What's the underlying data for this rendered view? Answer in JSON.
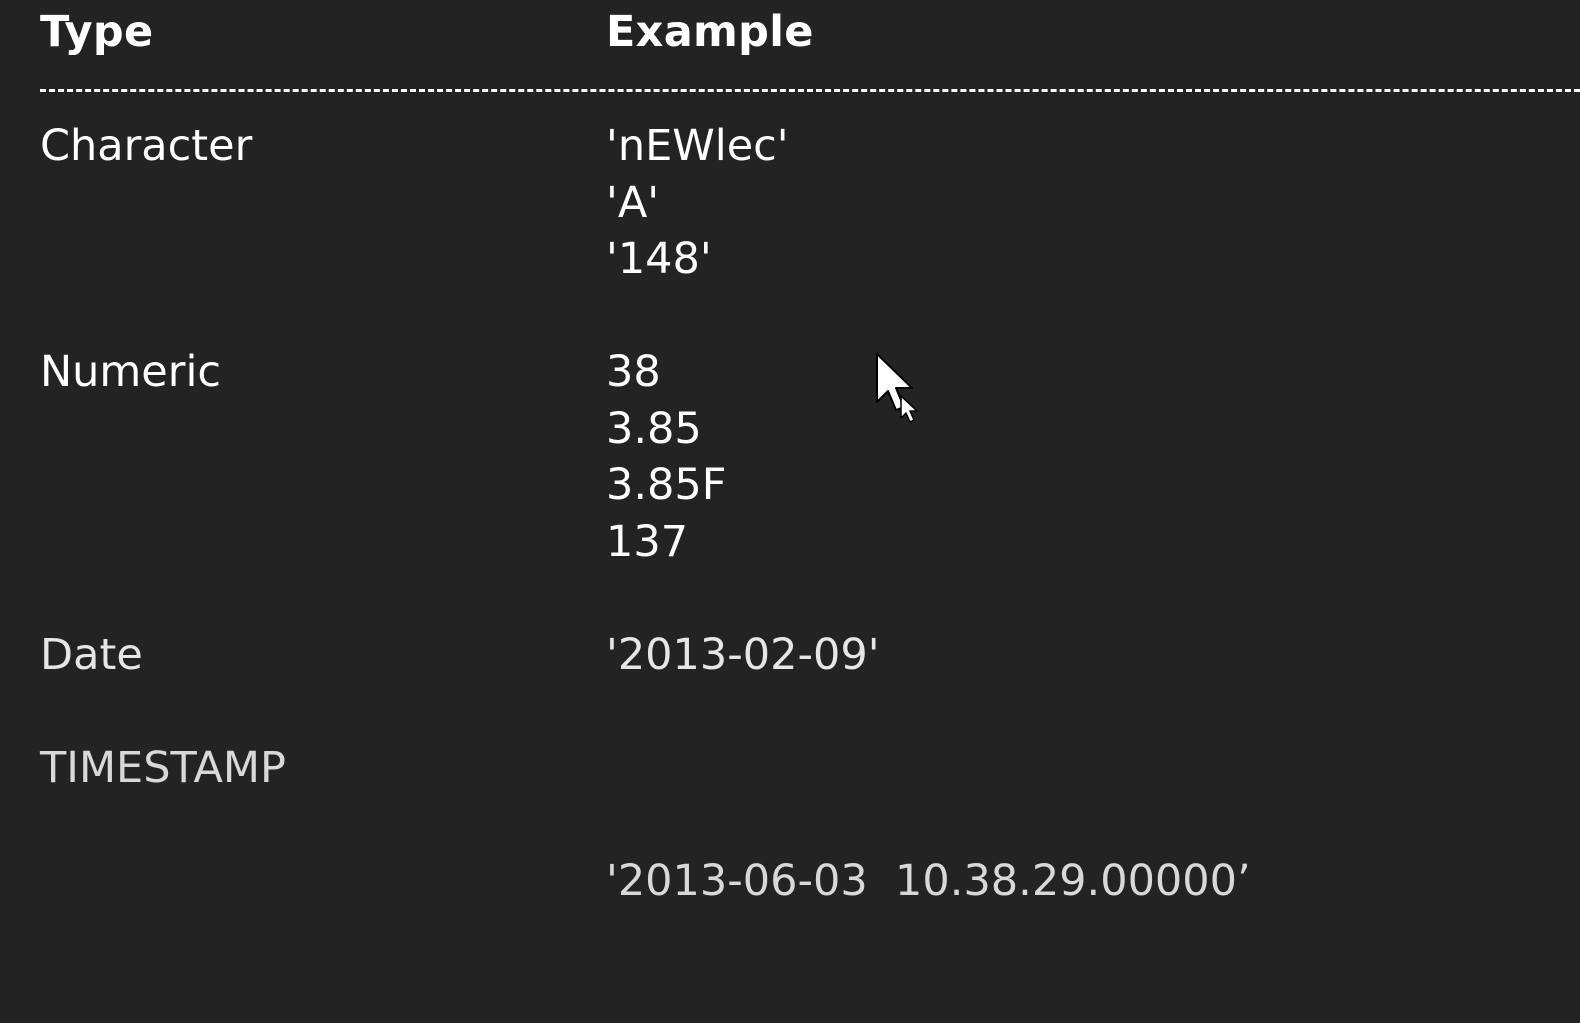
{
  "table": {
    "headers": {
      "type": "Type",
      "example": "Example"
    },
    "rows": [
      {
        "type": "Character",
        "examples": [
          "'nEWlec'",
          "'A'",
          "'148'"
        ]
      },
      {
        "type": "Numeric",
        "examples": [
          "38",
          "3.85",
          "3.85F",
          "137"
        ]
      },
      {
        "type": "Date",
        "examples": [
          "'2013-02-09'"
        ]
      },
      {
        "type": "TIMESTAMP",
        "examples": [
          "'2013-06-03  10.38.29.00000’"
        ]
      }
    ]
  },
  "colors": {
    "background": "#232323",
    "text": "#ffffff"
  },
  "icons": {
    "pointer": "mouse-pointer-icon"
  }
}
